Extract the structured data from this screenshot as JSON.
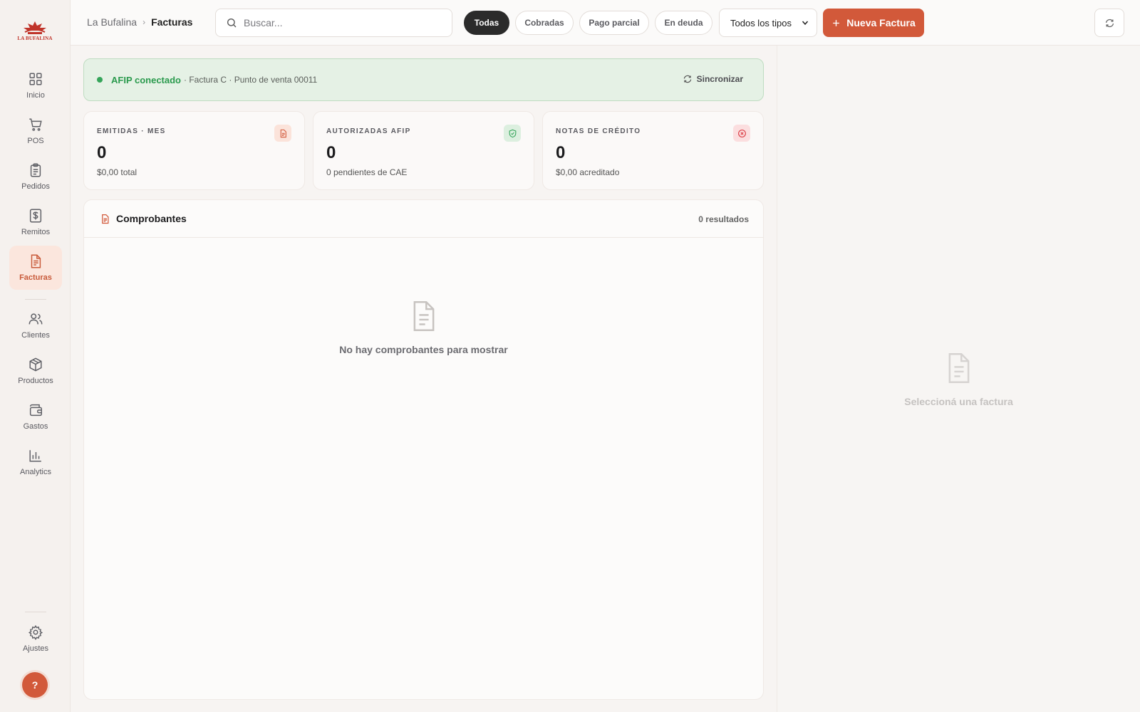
{
  "sidebar": {
    "logo_text": "LA BUFALINA",
    "items": [
      {
        "label": "Inicio",
        "icon": "grid-icon"
      },
      {
        "label": "POS",
        "icon": "cart-icon"
      },
      {
        "label": "Pedidos",
        "icon": "clipboard-icon"
      },
      {
        "label": "Remitos",
        "icon": "dollar-receipt-icon"
      },
      {
        "label": "Facturas",
        "icon": "invoice-icon",
        "active": true
      },
      {
        "label": "Clientes",
        "icon": "users-icon"
      },
      {
        "label": "Productos",
        "icon": "box-icon"
      },
      {
        "label": "Gastos",
        "icon": "wallet-icon"
      },
      {
        "label": "Analytics",
        "icon": "bar-chart-icon"
      },
      {
        "label": "Ajustes",
        "icon": "gear-icon"
      }
    ],
    "help_label": "?"
  },
  "header": {
    "breadcrumb_root": "La Bufalina",
    "breadcrumb_sep": "›",
    "breadcrumb_current": "Facturas",
    "search_placeholder": "Buscar...",
    "filters": [
      {
        "label": "Todas",
        "active": true
      },
      {
        "label": "Cobradas"
      },
      {
        "label": "Pago parcial"
      },
      {
        "label": "En deuda"
      }
    ],
    "type_select": "Todos los tipos",
    "new_button": "Nueva Factura"
  },
  "afip": {
    "status": "AFIP conectado",
    "detail": "· Factura C · Punto de venta 00011",
    "sync_label": "Sincronizar"
  },
  "kpis": [
    {
      "title": "EMITIDAS · MES",
      "value": "0",
      "sub": "$0,00 total",
      "color": "#d2593a"
    },
    {
      "title": "AUTORIZADAS AFIP",
      "value": "0",
      "sub": "0 pendientes de CAE",
      "color": "#35a55a"
    },
    {
      "title": "NOTAS DE CRÉDITO",
      "value": "0",
      "sub": "$0,00 acreditado",
      "color": "#d9363e"
    }
  ],
  "comprobantes": {
    "title": "Comprobantes",
    "count": "0 resultados",
    "empty_text": "No hay comprobantes para mostrar"
  },
  "detail": {
    "empty_text": "Seleccioná una factura"
  },
  "colors": {
    "accent": "#d2593a",
    "success": "#35a55a",
    "danger": "#d9363e"
  }
}
